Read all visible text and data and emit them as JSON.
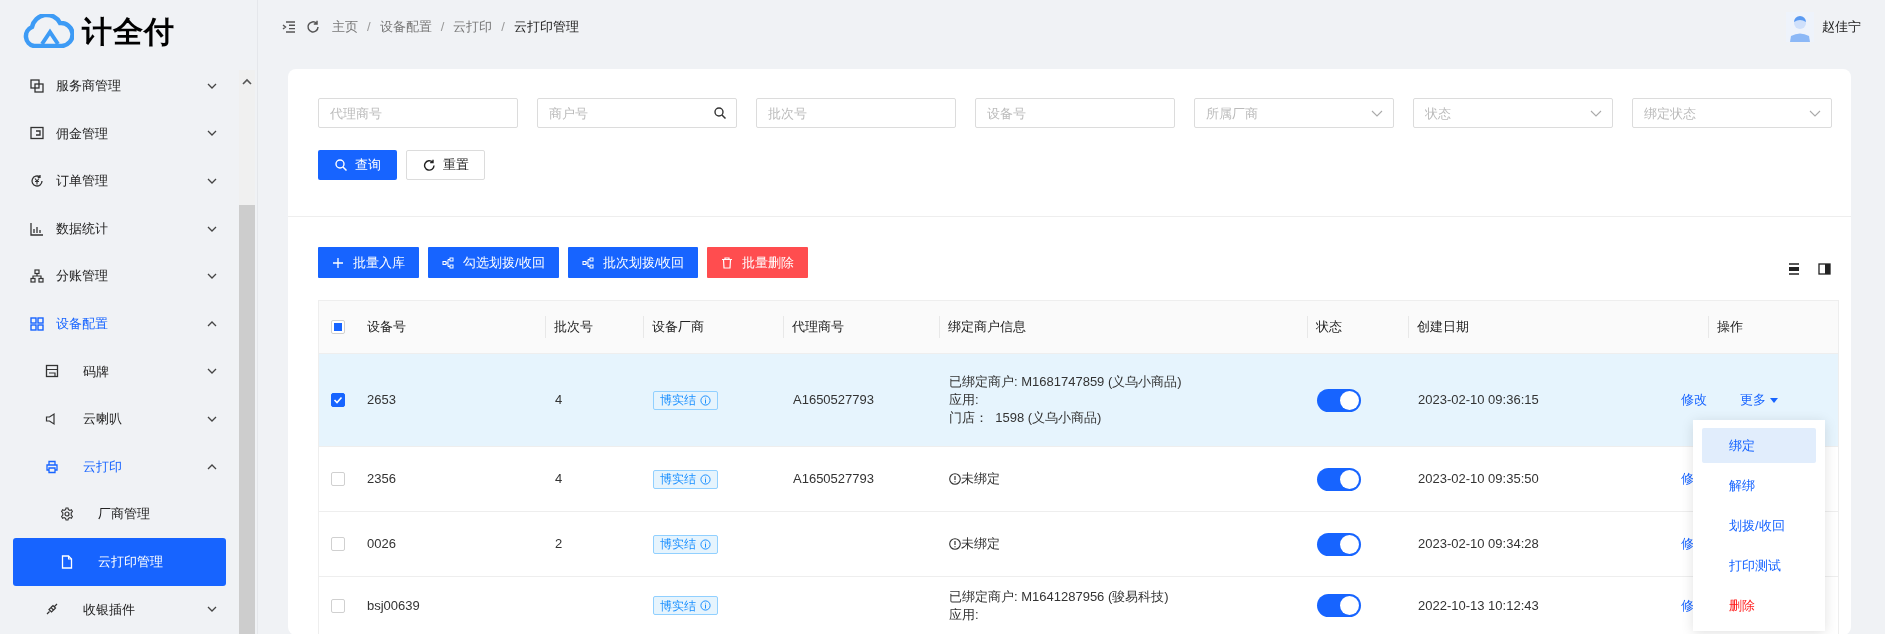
{
  "logo": {
    "text": "计全付"
  },
  "sidebar": {
    "menu": [
      {
        "label": "服务商管理",
        "expanded": false,
        "selected": false
      },
      {
        "label": "佣金管理",
        "expanded": false,
        "selected": false
      },
      {
        "label": "订单管理",
        "expanded": false,
        "selected": false
      },
      {
        "label": "数据统计",
        "expanded": false,
        "selected": false
      },
      {
        "label": "分账管理",
        "expanded": false,
        "selected": false
      },
      {
        "label": "设备配置",
        "expanded": true,
        "selected": false,
        "children": [
          {
            "label": "码牌",
            "expanded": false,
            "selected": false
          },
          {
            "label": "云喇叭",
            "expanded": false,
            "selected": false
          },
          {
            "label": "云打印",
            "expanded": true,
            "selected": false,
            "children": [
              {
                "label": "厂商管理",
                "selected": false
              },
              {
                "label": "云打印管理",
                "selected": true
              }
            ]
          },
          {
            "label": "收银插件",
            "expanded": false,
            "selected": false
          }
        ]
      }
    ]
  },
  "breadcrumb": [
    {
      "kind": "link",
      "text": "主页"
    },
    {
      "kind": "separator",
      "text": "/"
    },
    {
      "kind": "link",
      "text": "设备配置"
    },
    {
      "kind": "separator",
      "text": "/"
    },
    {
      "kind": "link",
      "text": "云打印"
    },
    {
      "kind": "separator",
      "text": "/"
    },
    {
      "kind": "current",
      "text": "云打印管理"
    }
  ],
  "user": {
    "name": "赵佳宁"
  },
  "filters": [
    {
      "kind": "input",
      "placeholder": "代理商号"
    },
    {
      "kind": "search",
      "placeholder": "商户号"
    },
    {
      "kind": "input",
      "placeholder": "批次号"
    },
    {
      "kind": "input",
      "placeholder": "设备号"
    },
    {
      "kind": "select",
      "placeholder": "所属厂商"
    },
    {
      "kind": "select",
      "placeholder": "状态"
    },
    {
      "kind": "select",
      "placeholder": "绑定状态"
    }
  ],
  "filter_buttons": [
    {
      "label": "查询",
      "kind": "primary"
    },
    {
      "label": "重置",
      "kind": "default"
    }
  ],
  "toolbar": [
    {
      "label": "批量入库",
      "kind": "primary"
    },
    {
      "label": "勾选划拨/收回",
      "kind": "primary"
    },
    {
      "label": "批次划拨/收回",
      "kind": "primary"
    },
    {
      "label": "批量删除",
      "kind": "danger"
    }
  ],
  "table": {
    "select_all": {
      "checked": false,
      "indeterminate": true
    },
    "columns": [
      "设备号",
      "批次号",
      "设备厂商",
      "代理商号",
      "绑定商户信息",
      "状态",
      "创建日期",
      "操作"
    ],
    "rows": [
      {
        "selected": true,
        "device_no": "2653",
        "batch_no": "4",
        "vendor": "博实结",
        "agent_no": "A1650527793",
        "binding": {
          "kind": "bound",
          "lines": [
            "已绑定商户: M1681747859 (义乌小商品)",
            "应用:",
            "门店：  1598 (义乌小商品)"
          ]
        },
        "on": true,
        "created": "2023-02-10 09:36:15",
        "edit": "修改",
        "more": "更多"
      },
      {
        "selected": false,
        "device_no": "2356",
        "batch_no": "4",
        "vendor": "博实结",
        "agent_no": "A1650527793",
        "binding": {
          "kind": "unbound",
          "lines": [
            "未绑定"
          ]
        },
        "on": true,
        "created": "2023-02-10 09:35:50",
        "edit": "修"
      },
      {
        "selected": false,
        "device_no": "0026",
        "batch_no": "2",
        "vendor": "博实结",
        "binding": {
          "kind": "unbound",
          "lines": [
            "未绑定"
          ]
        },
        "on": true,
        "created": "2023-02-10 09:34:28",
        "edit": "修"
      },
      {
        "selected": false,
        "device_no": "bsj00639",
        "vendor": "博实结",
        "binding": {
          "kind": "bound",
          "lines": [
            "已绑定商户: M1641287956 (骏易科技)",
            "应用:"
          ]
        },
        "on": true,
        "created": "2022-10-13 10:12:43",
        "edit": "修"
      }
    ]
  },
  "more_menu": [
    {
      "label": "绑定",
      "kind": "normal",
      "selected": true
    },
    {
      "label": "解绑",
      "kind": "normal",
      "selected": false
    },
    {
      "label": "划拨/收回",
      "kind": "normal",
      "selected": false
    },
    {
      "label": "打印测试",
      "kind": "normal",
      "selected": false
    },
    {
      "label": "删除",
      "kind": "danger",
      "selected": false
    }
  ]
}
